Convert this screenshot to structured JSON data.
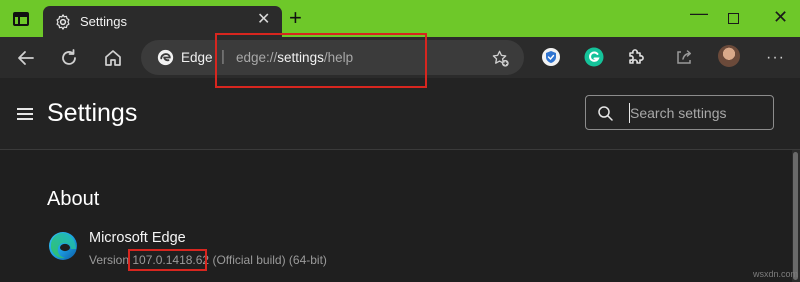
{
  "window": {
    "tab_title": "Settings",
    "tab_close": "✕",
    "new_tab": "+",
    "minimize": "—",
    "close": "✕"
  },
  "toolbar": {
    "address_site": "Edge",
    "address_separator": "|",
    "address_scheme": "edge://",
    "address_host": "settings",
    "address_path": "/help",
    "more": "···"
  },
  "header": {
    "title": "Settings",
    "search_placeholder": "Search settings"
  },
  "about": {
    "heading": "About",
    "product_name": "Microsoft Edge",
    "version_prefix": "Version ",
    "version_number": "107.0.1418.62",
    "version_suffix": " (Official build) (64-bit)"
  },
  "watermark": "wsxdn.com",
  "colors": {
    "titlebar": "#6ec829",
    "toolbar": "#2b2b2b",
    "page_background": "#1f1f1f",
    "highlight_box": "#d7261f"
  }
}
